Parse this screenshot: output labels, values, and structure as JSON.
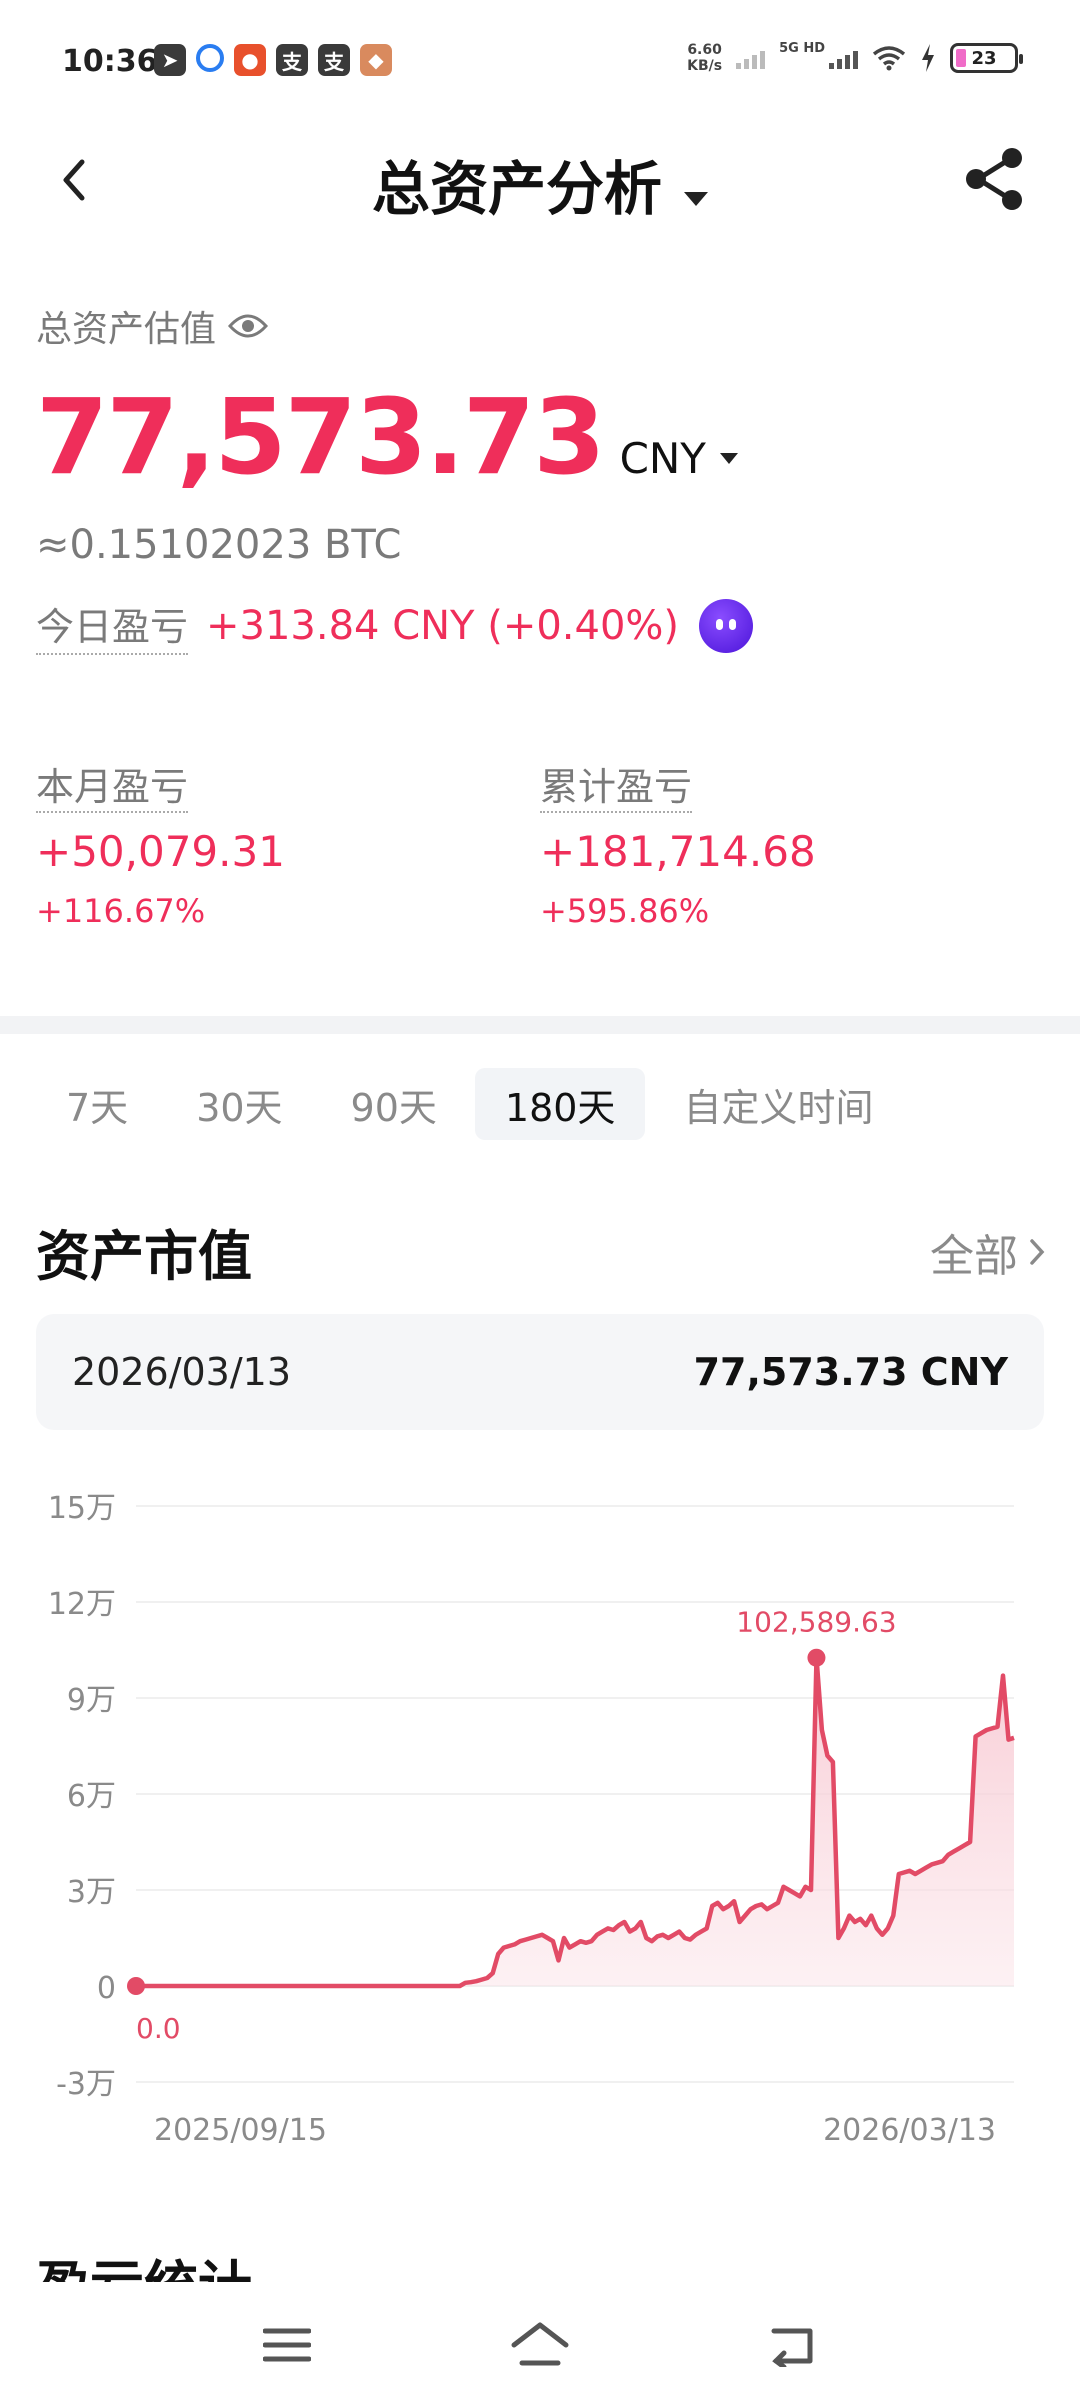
{
  "status_bar": {
    "time": "10:36",
    "net_speed_value": "6.60",
    "net_speed_unit": "KB/s",
    "network": "5G HD",
    "battery": "23"
  },
  "header": {
    "title": "总资产分析"
  },
  "summary": {
    "total_label": "总资产估值",
    "total_value": "77,573.73",
    "currency": "CNY",
    "btc_value": "≈0.15102023 BTC",
    "today_label": "今日盈亏",
    "today_value": "+313.84 CNY (+0.40%)"
  },
  "pl": {
    "month_label": "本月盈亏",
    "month_value": "+50,079.31",
    "month_pct": "+116.67%",
    "total_label": "累计盈亏",
    "total_value": "+181,714.68",
    "total_pct": "+595.86%"
  },
  "range_tabs": [
    {
      "label": "7天",
      "active": false
    },
    {
      "label": "30天",
      "active": false
    },
    {
      "label": "90天",
      "active": false
    },
    {
      "label": "180天",
      "active": true
    },
    {
      "label": "自定义时间",
      "active": false
    }
  ],
  "section": {
    "title": "资产市值",
    "all_label": "全部"
  },
  "info_card": {
    "date": "2026/03/13",
    "value": "77,573.73 CNY"
  },
  "chart_data": {
    "type": "area",
    "color": "#e24b66",
    "fill": "#fbe3e8",
    "ylim": [
      -30000,
      150000
    ],
    "yticks": [
      {
        "value": 150000,
        "label": "15万"
      },
      {
        "value": 120000,
        "label": "12万"
      },
      {
        "value": 90000,
        "label": "9万"
      },
      {
        "value": 60000,
        "label": "6万"
      },
      {
        "value": 30000,
        "label": "3万"
      },
      {
        "value": 0,
        "label": "0"
      },
      {
        "value": -30000,
        "label": "-3万"
      }
    ],
    "x_start_label": "2025/09/15",
    "x_end_label": "2026/03/13",
    "grid": true,
    "min_label": "0.0",
    "max_label": "102,589.63",
    "values": [
      0,
      0,
      0,
      0,
      0,
      0,
      0,
      0,
      0,
      0,
      0,
      0,
      0,
      0,
      0,
      0,
      0,
      0,
      0,
      0,
      0,
      0,
      0,
      0,
      0,
      0,
      0,
      0,
      0,
      0,
      0,
      0,
      0,
      0,
      0,
      0,
      0,
      0,
      0,
      0,
      0,
      0,
      0,
      0,
      0,
      0,
      0,
      0,
      0,
      0,
      0,
      0,
      0,
      0,
      0,
      0,
      0,
      0,
      0,
      0,
      1000,
      1200,
      1500,
      2000,
      2500,
      4000,
      10000,
      12000,
      12500,
      13000,
      14000,
      14500,
      15000,
      15500,
      16000,
      15000,
      14000,
      8000,
      15000,
      12000,
      13000,
      14000,
      13500,
      14000,
      16000,
      17000,
      18000,
      17500,
      19000,
      20000,
      17000,
      18000,
      20000,
      15000,
      14000,
      15500,
      16000,
      15000,
      16000,
      17000,
      15000,
      14500,
      16000,
      17000,
      18000,
      25000,
      26000,
      24000,
      25000,
      26500,
      20000,
      22000,
      24000,
      25000,
      25500,
      24000,
      25000,
      26000,
      31000,
      30000,
      29000,
      28000,
      31000,
      30000,
      102589.63,
      80000,
      72000,
      70000,
      15000,
      18000,
      22000,
      20000,
      21000,
      19000,
      22000,
      18000,
      16000,
      18000,
      22000,
      35000,
      35500,
      36000,
      35000,
      36000,
      37000,
      38000,
      38500,
      39000,
      41000,
      42000,
      43000,
      44000,
      45000,
      78000,
      79000,
      80000,
      80500,
      81000,
      97000,
      77000,
      77573.73
    ]
  },
  "next_section": {
    "title": "盈亏统计"
  }
}
